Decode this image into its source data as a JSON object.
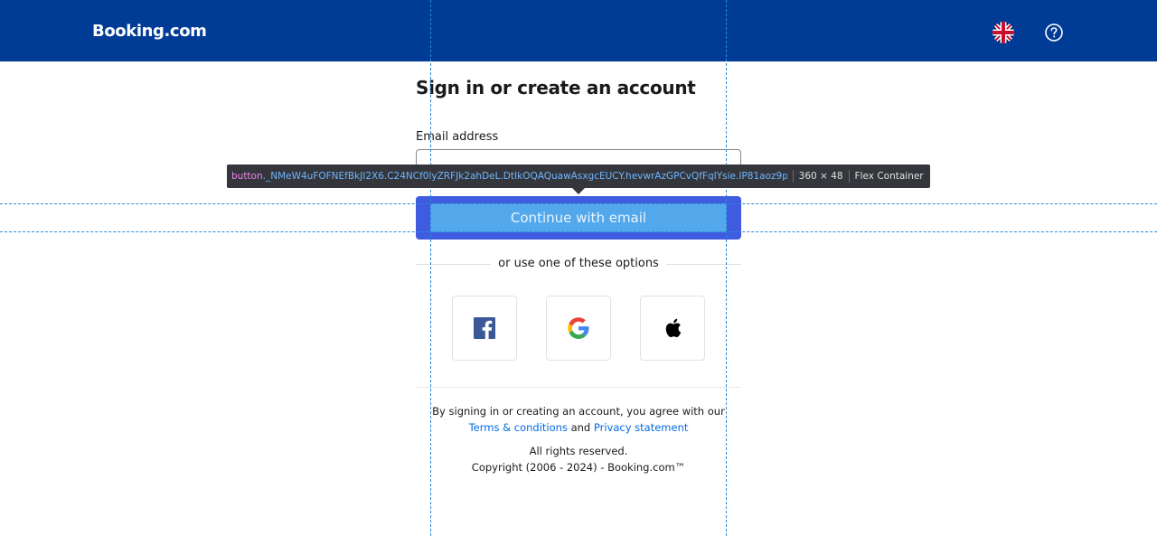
{
  "header": {
    "logo": "Booking.com",
    "language_icon": "uk-flag-icon",
    "help_icon": "question-circle-icon"
  },
  "form": {
    "heading": "Sign in or create an account",
    "email_label": "Email address",
    "email_value": "",
    "continue_label": "Continue with email",
    "divider_text": "or use one of these options"
  },
  "social": [
    {
      "name": "facebook",
      "icon": "facebook-icon"
    },
    {
      "name": "google",
      "icon": "google-icon"
    },
    {
      "name": "apple",
      "icon": "apple-icon"
    }
  ],
  "footer": {
    "agree_prefix": "By signing in or creating an account, you agree with our ",
    "terms_link": "Terms & conditions",
    "and_text": " and ",
    "privacy_link": "Privacy statement",
    "rights": "All rights reserved.",
    "copyright": "Copyright (2006 - 2024) - Booking.com™"
  },
  "devtools_tooltip": {
    "tag": "button",
    "classes": "._NMeW4uFOFNEfBkJI2X6.C24NCf0lyZRFJk2ahDeL.DtIkOQAQuawAsxgcEUCY.hevwrAzGPCvQfFqIYsie.IP81aoz9pM2…",
    "size": "360 × 48",
    "badge": "Flex Container"
  },
  "colors": {
    "brand_blue": "#003b95",
    "link": "#006ce4",
    "button_outer": "#3f5ce0",
    "button_inner": "#52a8ea"
  }
}
